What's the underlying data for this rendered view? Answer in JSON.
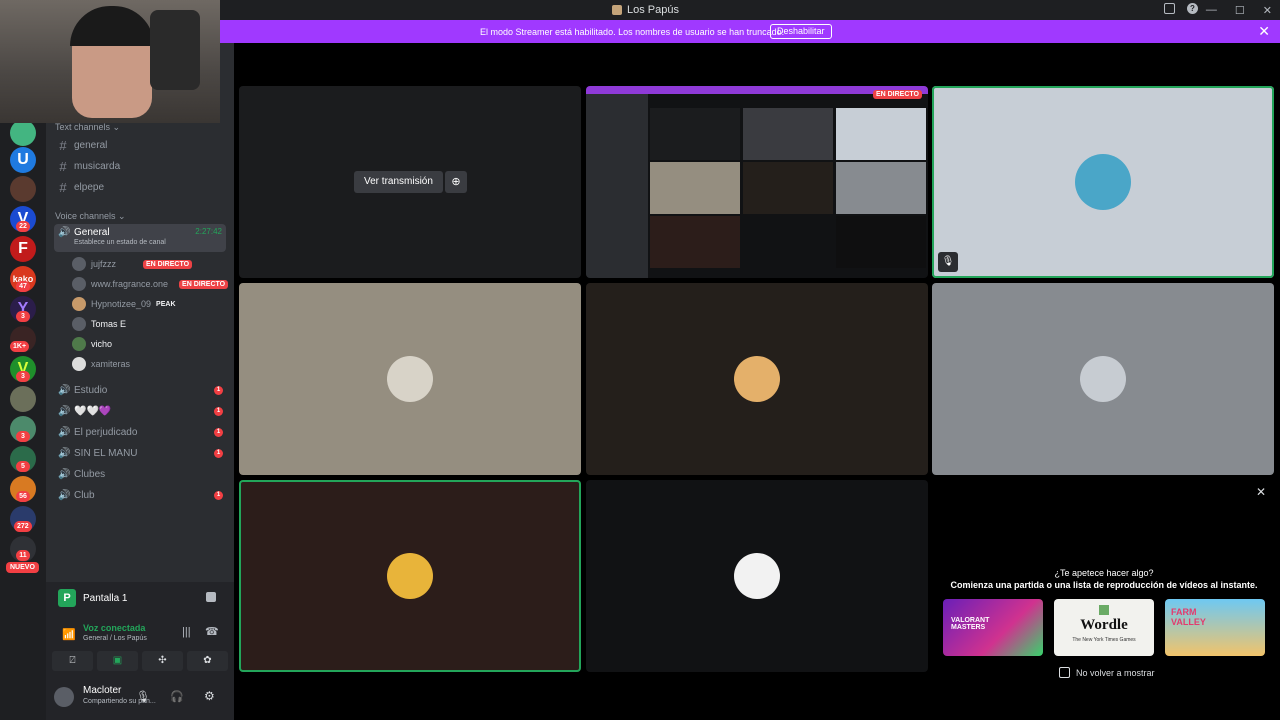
{
  "window": {
    "title": "Los Papús",
    "controls": [
      "—",
      "☐",
      "✕"
    ]
  },
  "banner": {
    "message": "El modo Streamer está habilitado. Los nombres de usuario se han truncado.",
    "button": "Deshabilitar",
    "close": "✕"
  },
  "rail": {
    "badges": [
      "22",
      "47",
      "3",
      "1K+",
      "3",
      "3",
      "5",
      "56",
      "272",
      "11"
    ],
    "new_label": "NUEVO"
  },
  "sidebar": {
    "text_category": "Text channels",
    "text_channels": [
      "general",
      "musicarda",
      "elpepe"
    ],
    "voice_category": "Voice channels",
    "active_voice": {
      "name": "General",
      "timer": "2:27:42",
      "status": "Establece un estado de canal"
    },
    "voice_users": [
      {
        "name": "jujfzzz",
        "tag": "EN DIRECTO"
      },
      {
        "name": "www.fragrance.one",
        "tag": "EN DIRECTO"
      },
      {
        "name": "Hypnotizee_09",
        "tag": "PEAK"
      },
      {
        "name": "Tomas E",
        "tag": ""
      },
      {
        "name": "vicho",
        "tag": ""
      },
      {
        "name": "xamiteras",
        "tag": ""
      }
    ],
    "other_voice": [
      {
        "name": "Estudio",
        "badge": "1"
      },
      {
        "name": "🤍🤍💜",
        "badge": "1"
      },
      {
        "name": "El perjudicado",
        "badge": "1"
      },
      {
        "name": "SIN EL MANU",
        "badge": "1"
      },
      {
        "name": "Clubes",
        "badge": ""
      },
      {
        "name": "Club",
        "badge": "1"
      }
    ]
  },
  "rtc": {
    "screen_label": "Pantalla 1",
    "status": "Voz conectada",
    "location": "General / Los Papús"
  },
  "user": {
    "name": "Macloter",
    "status": "Compartiendo su pan..."
  },
  "stage": {
    "watch_label": "Ver transmisión",
    "live_label": "EN DIRECTO"
  },
  "activities": {
    "question": "¿Te apetece hacer algo?",
    "subtitle": "Comienza una partida o una lista de reproducción de vídeos al instante.",
    "cards": [
      "VALORANT MASTERS",
      "Wordle",
      "FARM VALLEY"
    ],
    "wordle_sub": "The New York Times Games",
    "dont_show": "No volver a mostrar"
  }
}
